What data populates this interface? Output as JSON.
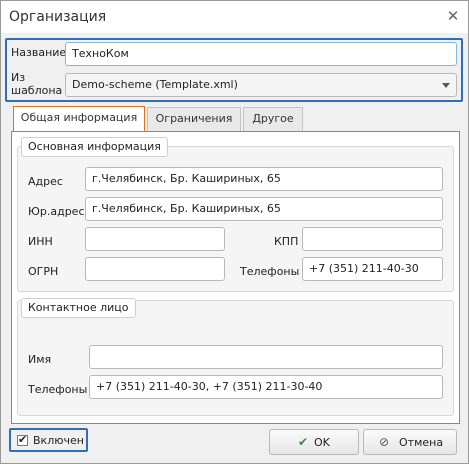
{
  "window": {
    "title": "Организация"
  },
  "header": {
    "name_label": "Название",
    "name_value": "ТехноКом",
    "template_label_line1": "Из",
    "template_label_line2": "шаблона",
    "template_value": "Demo-scheme (Template.xml)"
  },
  "tabs": [
    {
      "label": "Общая информация",
      "active": true
    },
    {
      "label": "Ограничения",
      "active": false
    },
    {
      "label": "Другое",
      "active": false
    }
  ],
  "basic_info": {
    "legend": "Основная информация",
    "address_label": "Адрес",
    "address_value": "г.Челябинск, Бр. Кашириных, 65",
    "legal_address_label": "Юр.адрес",
    "legal_address_value": "г.Челябинск, Бр. Кашириных, 65",
    "inn_label": "ИНН",
    "inn_value": "",
    "kpp_label": "КПП",
    "kpp_value": "",
    "ogrn_label": "ОГРН",
    "ogrn_value": "",
    "phones_label": "Телефоны",
    "phones_value": "+7 (351) 211-40-30"
  },
  "contact": {
    "legend": "Контактное лицо",
    "name_label": "Имя",
    "name_value": "",
    "phones_label": "Телефоны",
    "phones_value": "+7 (351) 211-40-30, +7 (351) 211-30-40"
  },
  "footer": {
    "enabled_label": "Включен",
    "enabled_checked": true,
    "ok_label": "OK",
    "cancel_label": "Отмена"
  },
  "colors": {
    "focus_border": "#2f6fb5",
    "tab_accent": "#e07020",
    "ok_check": "#3a8a3a",
    "cancel_icon": "#555555"
  },
  "icons": {
    "close": "close-icon",
    "dropdown": "chevron-down-icon",
    "ok": "check-icon",
    "cancel": "cancel-icon"
  }
}
